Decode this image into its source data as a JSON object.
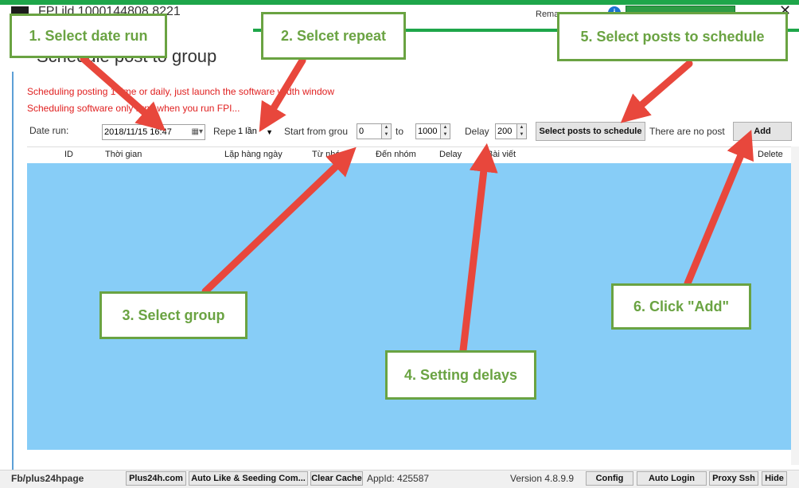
{
  "window": {
    "title": "FPI          ild     1000144808 8221",
    "rema_text": "Rema",
    "minimize_label": "_",
    "close_label": "✕"
  },
  "form": {
    "heading": "Schedule post to group",
    "note1": "Scheduling posting 1 time or daily, just launch the software width window",
    "note2": "Scheduling software only runs when you run FPI...",
    "date_label": "Date run:",
    "date_value": "2018/11/15 16:47",
    "repeat_label": "Repe",
    "repeat_value": "1 lần",
    "start_label": "Start from grou",
    "start_value": "0",
    "to_label": "to",
    "to_value": "1000",
    "delay_label": "Delay",
    "delay_value": "200",
    "select_posts_button": "Select posts to schedule",
    "no_post_text": "There are no post",
    "add_button": "Add"
  },
  "grid": {
    "columns": [
      "ID",
      "Thời gian",
      "Lặp hàng ngày",
      "Từ nhó",
      "Đến nhóm",
      "Delay",
      "Bài viết",
      "Delete"
    ],
    "rows": []
  },
  "status_bar": {
    "fb_text": "Fb/plus24hpage",
    "plus24h_button": "Plus24h.com",
    "autolike_button": "Auto Like & Seeding Com...",
    "clear_cache_button": "Clear Cache",
    "appid_text": "AppId: 425587",
    "version_text": "Version 4.8.9.9",
    "config_button": "Config",
    "auto_login_button": "Auto Login",
    "proxy_ssh_button": "Proxy Ssh",
    "hide_button": "Hide"
  },
  "callouts": {
    "c1": "1. Select date run",
    "c2": "2. Selcet repeat",
    "c3": "3. Select group",
    "c4": "4. Setting delays",
    "c5": "5. Select posts to schedule",
    "c6": "6. Click \"Add\""
  },
  "colors": {
    "accent_green": "#1ea64a",
    "callout_green": "#6aa342",
    "arrow_red": "#e8473c",
    "grid_blue": "#87cdf7",
    "note_red": "#e02020"
  }
}
